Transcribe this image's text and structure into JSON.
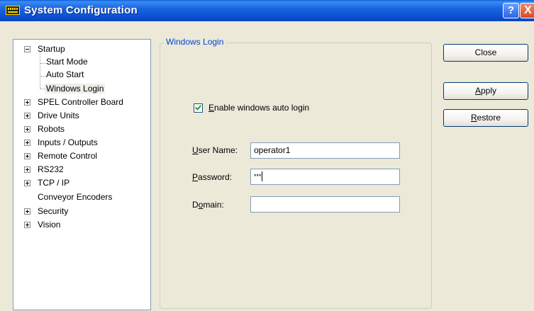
{
  "window": {
    "title": "System Configuration",
    "help_label": "?",
    "close_label": "X"
  },
  "tree": {
    "items": [
      {
        "label": "Startup",
        "expander": "minus"
      },
      {
        "label": "Start Mode"
      },
      {
        "label": "Auto Start"
      },
      {
        "label": "Windows Login",
        "selected": true
      },
      {
        "label": "SPEL Controller Board",
        "expander": "plus"
      },
      {
        "label": "Drive Units",
        "expander": "plus"
      },
      {
        "label": "Robots",
        "expander": "plus"
      },
      {
        "label": "Inputs / Outputs",
        "expander": "plus"
      },
      {
        "label": "Remote Control",
        "expander": "plus"
      },
      {
        "label": "RS232",
        "expander": "plus"
      },
      {
        "label": "TCP / IP",
        "expander": "plus"
      },
      {
        "label": "Conveyor Encoders"
      },
      {
        "label": "Security",
        "expander": "plus"
      },
      {
        "label": "Vision",
        "expander": "plus"
      }
    ]
  },
  "panel": {
    "group_title": "Windows Login",
    "auto_login": {
      "label_accel": "E",
      "label_rest": "nable windows auto login",
      "checked": true
    },
    "user_name": {
      "label_accel": "U",
      "label_rest": "ser Name:",
      "value": "operator1"
    },
    "password": {
      "label_accel": "P",
      "label_rest": "assword:",
      "value": "***"
    },
    "domain": {
      "label_pre": "D",
      "label_accel": "o",
      "label_rest": "main:",
      "value": ""
    }
  },
  "buttons": {
    "close": "Close",
    "apply_accel": "A",
    "apply_rest": "pply",
    "restore_accel": "R",
    "restore_rest": "estore"
  },
  "colors": {
    "titlebar": "#0b4fd0",
    "group_title": "#0046d5",
    "dialog_bg": "#ece9d8"
  }
}
